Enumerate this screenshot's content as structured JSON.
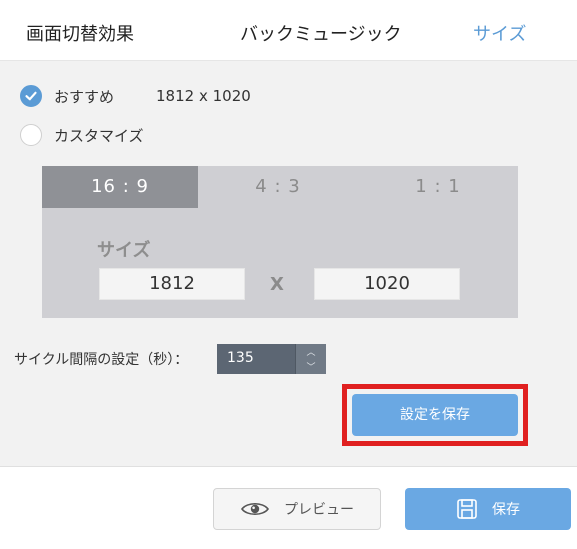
{
  "tabs": [
    {
      "label": "画面切替効果"
    },
    {
      "label": "バックミュージック"
    },
    {
      "label": "サイズ"
    }
  ],
  "size_options": {
    "recommended": {
      "label": "おすすめ",
      "dimensions": "1812 x 1020",
      "checked": true
    },
    "custom": {
      "label": "カスタマイズ",
      "checked": false
    }
  },
  "ratio_tabs": [
    {
      "label": "16 : 9",
      "selected": true
    },
    {
      "label": "4 : 3",
      "selected": false
    },
    {
      "label": "1 : 1",
      "selected": false
    }
  ],
  "size_panel": {
    "label": "サイズ",
    "width": "1812",
    "separator": "X",
    "height": "1020"
  },
  "cycle": {
    "label": "サイクル間隔の設定（秒）：",
    "value": "135"
  },
  "save_settings_button": "設定を保存",
  "footer": {
    "preview_label": "プレビュー",
    "save_label": "保存"
  },
  "colors": {
    "accent": "#6aa8e3",
    "active_tab": "#5b9bd5",
    "highlight": "#e02020"
  }
}
